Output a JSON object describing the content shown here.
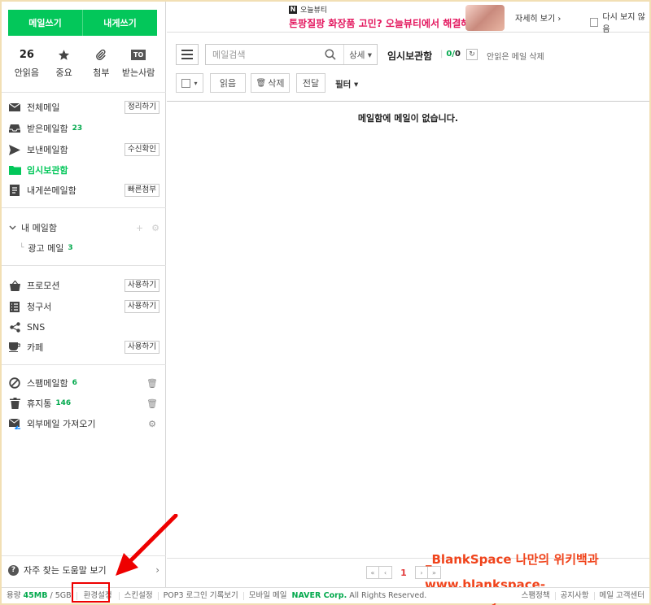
{
  "sidebar": {
    "write_mail": "메일쓰기",
    "write_to_me": "내게쓰기",
    "quick": [
      {
        "top": "26",
        "label": "안읽음"
      },
      {
        "icon": "star-icon",
        "label": "중요"
      },
      {
        "icon": "paperclip-icon",
        "label": "첨부"
      },
      {
        "top": "TO",
        "label": "받는사람"
      }
    ],
    "mailboxes": [
      {
        "label": "전체메일",
        "button": "정리하기"
      },
      {
        "label": "받은메일함",
        "count": "23"
      },
      {
        "label": "보낸메일함",
        "button": "수신확인"
      },
      {
        "label": "임시보관함"
      },
      {
        "label": "내게쓴메일함",
        "button": "빠른첨부"
      }
    ],
    "my_folders_title": "내 메일함",
    "my_folders": [
      {
        "label": "광고 메일",
        "count": "3"
      }
    ],
    "apps": [
      {
        "label": "프로모션",
        "button": "사용하기"
      },
      {
        "label": "청구서",
        "button": "사용하기"
      },
      {
        "label": "SNS"
      },
      {
        "label": "카페",
        "button": "사용하기"
      }
    ],
    "spam": {
      "label": "스팸메일함",
      "count": "6"
    },
    "trash": {
      "label": "휴지통",
      "count": "146"
    },
    "external": {
      "label": "외부메일 가져오기"
    },
    "help": "자주 찾는 도움말 보기"
  },
  "ad": {
    "brand": "오늘뷰티",
    "headline": "톤팡질팡 화장품 고민? 오늘뷰티에서 해결해!",
    "more": "자세히 보기 ›",
    "noshow": "다시 보지 않음"
  },
  "toolbar": {
    "search_placeholder": "메일검색",
    "detail": "상세 ▾",
    "folder_name": "임시보관함",
    "count_unread": "0",
    "count_total": "0",
    "refresh": "↻",
    "unread_delete": "안읽은 메일 삭제",
    "read": "읽음",
    "delete": "삭제",
    "forward": "전달",
    "filter": "필터 ▾"
  },
  "main": {
    "empty_message": "메일함에 메일이 없습니다."
  },
  "pager": {
    "current": "1"
  },
  "watermark": {
    "line1": "_BlankSpace 나만의 위키백과",
    "line2": "www.blankspace-dev.tistory.com"
  },
  "footer": {
    "usage_label": "용량",
    "usage_value": "45MB",
    "usage_total": "/ 5GB",
    "settings": "환경설정",
    "skin": "스킨설정",
    "pop3": "POP3 로그인 기록보기",
    "mobile": "모바일 메일",
    "naver": "NAVER Corp.",
    "rights": "All Rights Reserved.",
    "spam_policy": "스팸정책",
    "notice": "공지사항",
    "support": "메일 고객센터"
  },
  "colors": {
    "accent": "#03c75a",
    "accent_dark": "#03a94d",
    "ad_pink": "#e3185f",
    "watermark": "#f0441c",
    "highlight": "#ee0000"
  }
}
